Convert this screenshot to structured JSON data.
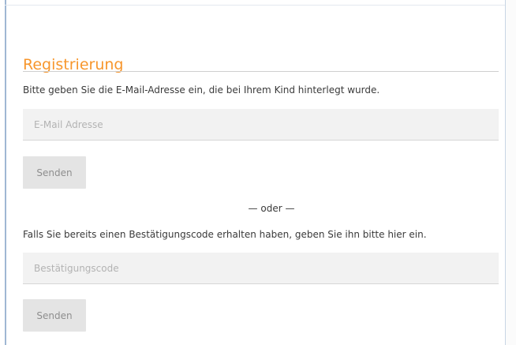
{
  "registration": {
    "title": "Registrierung",
    "email_instruction": "Bitte geben Sie die E-Mail-Adresse ein, die bei Ihrem Kind hinterlegt wurde.",
    "email_placeholder": "E-Mail Adresse",
    "email_value": "",
    "email_submit_label": "Senden",
    "divider_text": "— oder —",
    "code_instruction": "Falls Sie bereits einen Bestätigungscode erhalten haben, geben Sie ihn bitte hier ein.",
    "code_placeholder": "Bestätigungscode",
    "code_value": "",
    "code_submit_label": "Senden"
  },
  "colors": {
    "title_accent": "#f7962c",
    "field_background": "#f2f2f2",
    "button_background": "#e4e4e4",
    "button_text": "#8e8e8e",
    "body_text": "#3a3a3a",
    "frame_border": "#9fb7d3"
  }
}
